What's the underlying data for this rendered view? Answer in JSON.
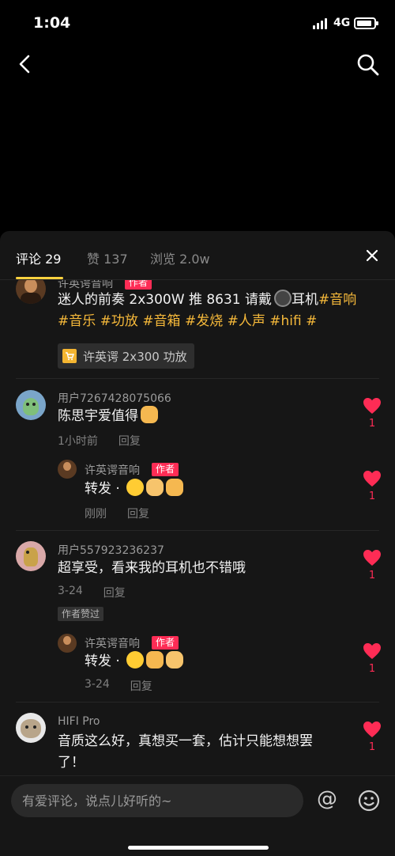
{
  "status_bar": {
    "time": "1:04",
    "network": "4G"
  },
  "sheet": {
    "tabs": [
      {
        "label": "评论 29"
      },
      {
        "label": "赞 137"
      },
      {
        "label": "浏览 2.0w"
      }
    ]
  },
  "colors": {
    "accent": "#ffd23f",
    "like": "#fe2c55",
    "hashtag": "#f6b93a",
    "background": "#161616"
  },
  "post": {
    "author": "许英谔音响",
    "author_badge": "作者",
    "text_prefix": "迷人的前奏 2x300W 推 8631 请戴",
    "text_after_icon": "耳机",
    "hashtags": [
      "#音响",
      "#音乐",
      "#功放",
      "#音箱",
      "#发烧",
      "#人声",
      "#hifi",
      "#"
    ],
    "product_tag": "许英谔 2x300 功放",
    "icons": [
      "headset-icon",
      "cart-icon"
    ]
  },
  "comments": [
    {
      "user": "用户7267428075066",
      "text": "陈思宇爱值得",
      "time": "1小时前",
      "reply_label": "回复",
      "likes": "1",
      "reply": {
        "user": "许英谔音响",
        "badge": "作者",
        "text": "转发 ·",
        "time": "刚刚",
        "reply_label": "回复",
        "likes": "1"
      }
    },
    {
      "user": "用户557923236237",
      "text": "超享受，看来我的耳机也不错哦",
      "time": "3-24",
      "reply_label": "回复",
      "likes": "1",
      "author_liked": "作者赞过",
      "reply": {
        "user": "许英谔音响",
        "badge": "作者",
        "text": "转发 ·",
        "time": "3-24",
        "reply_label": "回复",
        "likes": "1"
      }
    },
    {
      "user": "HIFI Pro",
      "text_line1": "音质这么好，真想买一套，估计只能想想罢",
      "text_line2": "了！",
      "likes": "1"
    }
  ],
  "input": {
    "placeholder": "有爱评论，说点儿好听的~",
    "at_symbol": "@"
  }
}
